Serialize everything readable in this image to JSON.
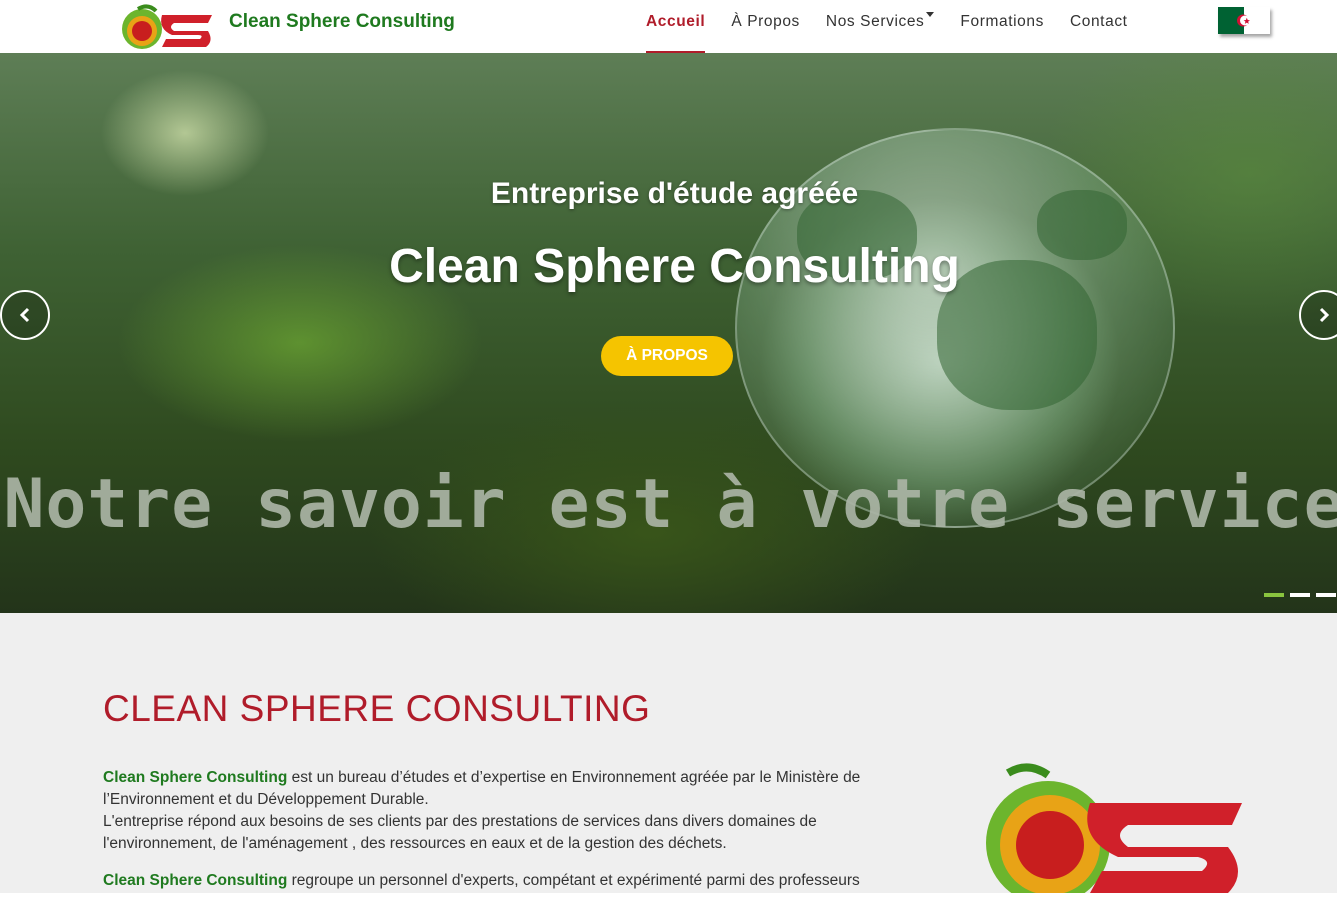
{
  "brand": {
    "name": "Clean Sphere Consulting"
  },
  "nav": {
    "items": [
      {
        "label": "Accueil"
      },
      {
        "label": "À Propos"
      },
      {
        "label": "Nos Services"
      },
      {
        "label": "Formations"
      },
      {
        "label": "Contact"
      }
    ]
  },
  "hero": {
    "subtitle": "Entreprise d'étude agréée",
    "title": "Clean Sphere Consulting",
    "button_label": "À PROPOS",
    "slogan": "Notre savoir est à votre service"
  },
  "about": {
    "title": "CLEAN SPHERE CONSULTING",
    "p1_strong": "Clean Sphere Consulting",
    "p1_rest": " est un bureau d’études et d’expertise en Environnement agréée par le Ministère de l’Environnement et du Développement Durable.",
    "p1_line2": "L'entreprise répond aux besoins de ses clients par des prestations de services dans divers domaines de l'environnement, de l'aménagement , des ressources en eaux et de la gestion des déchets.",
    "p2_strong": "Clean Sphere Consulting",
    "p2_rest": " regroupe un personnel d'experts, compétant et expérimenté parmi des professeurs"
  },
  "colors": {
    "brand_green": "#1f7a1f",
    "accent_red": "#b01c2a",
    "button_yellow": "#f5c400"
  }
}
